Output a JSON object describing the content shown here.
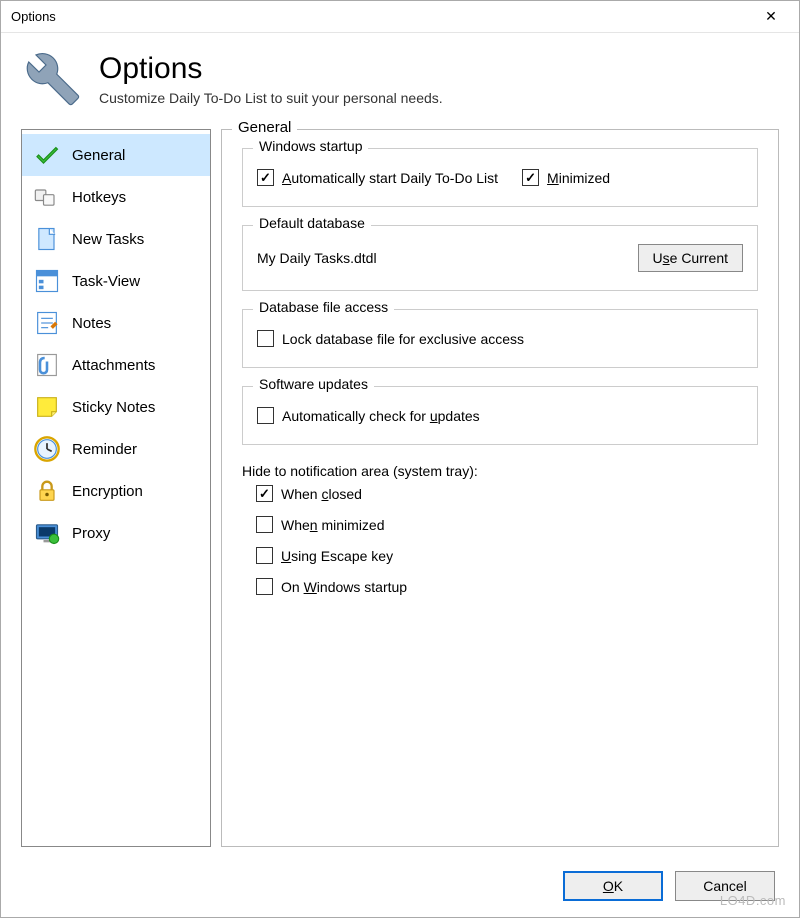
{
  "window": {
    "title": "Options"
  },
  "header": {
    "title": "Options",
    "subtitle": "Customize Daily To-Do List to suit your personal needs."
  },
  "sidebar": {
    "items": [
      {
        "label": "General",
        "selected": true
      },
      {
        "label": "Hotkeys",
        "selected": false
      },
      {
        "label": "New Tasks",
        "selected": false
      },
      {
        "label": "Task-View",
        "selected": false
      },
      {
        "label": "Notes",
        "selected": false
      },
      {
        "label": "Attachments",
        "selected": false
      },
      {
        "label": "Sticky Notes",
        "selected": false
      },
      {
        "label": "Reminder",
        "selected": false
      },
      {
        "label": "Encryption",
        "selected": false
      },
      {
        "label": "Proxy",
        "selected": false
      }
    ]
  },
  "main": {
    "frame_label": "General",
    "windows_startup": {
      "label": "Windows startup",
      "auto_start_label": "Automatically start Daily To-Do List",
      "auto_start_checked": true,
      "minimized_label": "Minimized",
      "minimized_checked": true
    },
    "default_database": {
      "label": "Default database",
      "filename": "My Daily Tasks.dtdl",
      "use_current_label": "Use Current"
    },
    "db_file_access": {
      "label": "Database file access",
      "lock_label": "Lock database file for exclusive access",
      "lock_checked": false
    },
    "software_updates": {
      "label": "Software updates",
      "auto_check_label": "Automatically check for updates",
      "auto_check_checked": false
    },
    "hide_tray": {
      "label": "Hide to notification area (system tray):",
      "when_closed_label": "When closed",
      "when_closed_checked": true,
      "when_minimized_label": "When minimized",
      "when_minimized_checked": false,
      "escape_label": "Using Escape key",
      "escape_checked": false,
      "on_startup_label": "On Windows startup",
      "on_startup_checked": false
    }
  },
  "footer": {
    "ok_label": "OK",
    "cancel_label": "Cancel"
  },
  "watermark": "LO4D.com"
}
